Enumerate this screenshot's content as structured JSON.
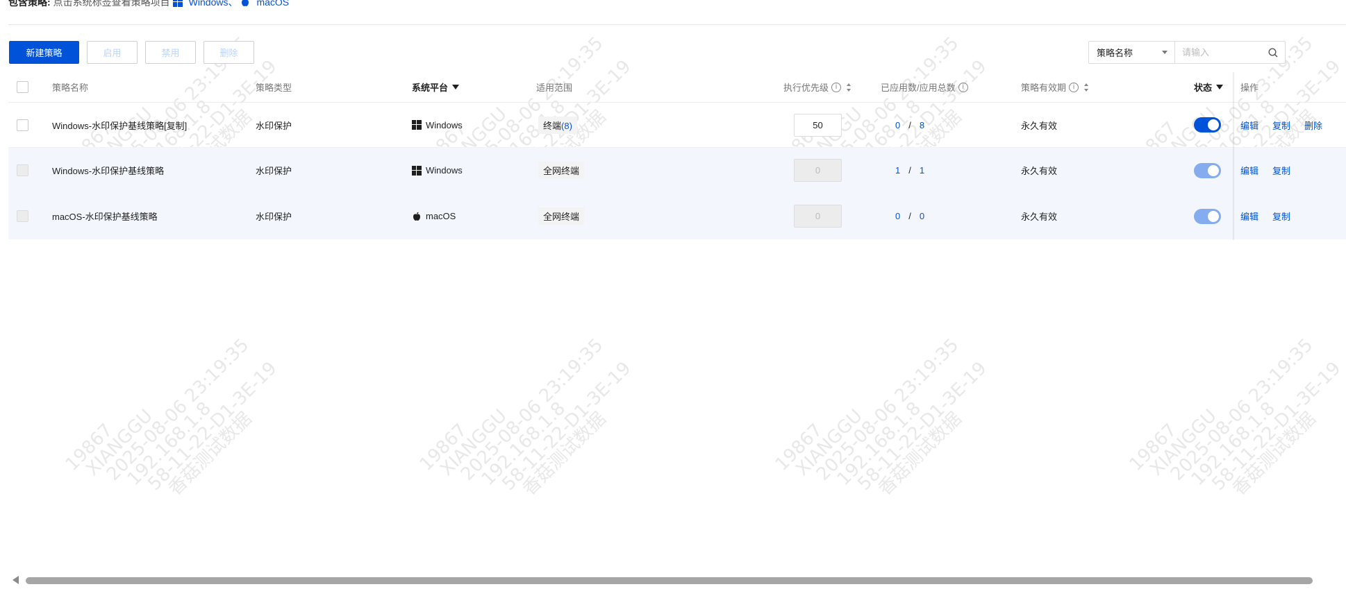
{
  "header": {
    "strategy_label": "包含策略:",
    "strategy_hint": "点击系统标签查看策略项目",
    "platforms": [
      "Windows、",
      "macOS"
    ]
  },
  "toolbar": {
    "new_label": "新建策略",
    "enable_label": "启用",
    "disable_label": "禁用",
    "delete_label": "删除"
  },
  "search": {
    "field": "策略名称",
    "placeholder": "请输入"
  },
  "table": {
    "columns": {
      "name": "策略名称",
      "type": "策略类型",
      "platform": "系统平台",
      "scope": "适用范围",
      "priority": "执行优先级",
      "applied": "已应用数/应用总数",
      "validity": "策略有效期",
      "status": "状态",
      "actions": "操作"
    },
    "rows": [
      {
        "name": "Windows-水印保护基线策略[复制]",
        "type": "水印保护",
        "platform": "Windows",
        "platform_icon": "windows-icon",
        "scope_text": "终端",
        "scope_count": "(8)",
        "priority": "50",
        "applied": "0",
        "total": "8",
        "validity": "永久有效",
        "status": "on",
        "actions": [
          "编辑",
          "复制",
          "删除"
        ]
      },
      {
        "name": "Windows-水印保护基线策略",
        "type": "水印保护",
        "platform": "Windows",
        "platform_icon": "windows-icon",
        "scope_text": "全网终端",
        "scope_count": "",
        "priority": "0",
        "applied": "1",
        "total": "1",
        "validity": "永久有效",
        "status": "on-disabled",
        "actions": [
          "编辑",
          "复制"
        ]
      },
      {
        "name": "macOS-水印保护基线策略",
        "type": "水印保护",
        "platform": "macOS",
        "platform_icon": "apple-icon",
        "scope_text": "全网终端",
        "scope_count": "",
        "priority": "0",
        "applied": "0",
        "total": "0",
        "validity": "永久有效",
        "status": "on-disabled",
        "actions": [
          "编辑",
          "复制"
        ]
      }
    ],
    "separator": "/"
  },
  "watermark": {
    "lines": [
      "19867",
      "XIANGGU",
      "2025-08-06 23:19:35",
      "192.168.1.8",
      "58-11-22-D1-3E-19",
      "香菇测试数据"
    ]
  },
  "colors": {
    "primary": "#0052d9",
    "disabled_border": "#bbd3fb",
    "row_shade": "#f3f7fd"
  }
}
